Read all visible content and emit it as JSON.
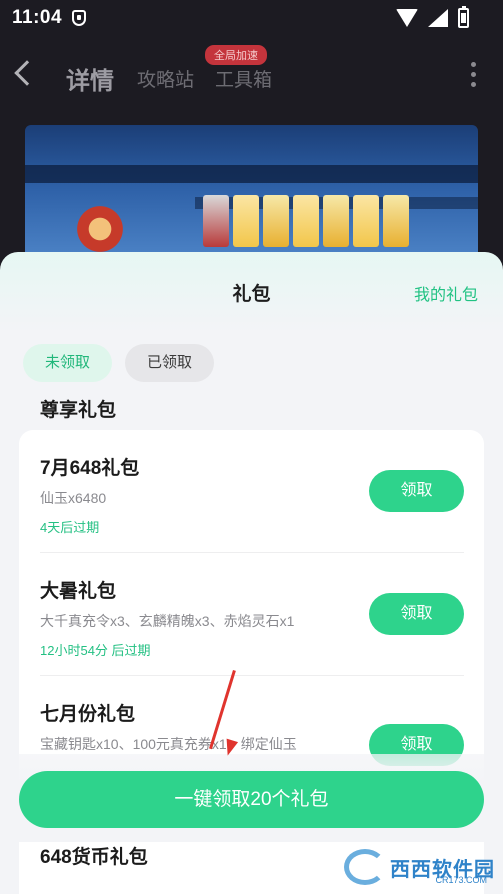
{
  "status_bar": {
    "time": "11:04"
  },
  "nav": {
    "back_icon": "back-arrow-icon",
    "title": "详情",
    "tabs": [
      "攻略站",
      "工具箱"
    ],
    "badge": "全局加速",
    "more_icon": "more-vertical-icon"
  },
  "sheet": {
    "title": "礼包",
    "my_gifts_link": "我的礼包",
    "segments": {
      "unclaimed": "未领取",
      "claimed": "已领取"
    },
    "section_title": "尊享礼包",
    "items": [
      {
        "name": "7月648礼包",
        "desc": "仙玉x6480",
        "expiry": "4天后过期",
        "button": "领取"
      },
      {
        "name": "大暑礼包",
        "desc": "大千真充令x3、玄麟精魄x3、赤焰灵石x1",
        "expiry": "12小时54分 后过期",
        "button": "领取"
      },
      {
        "name": "七月份礼包",
        "desc": "宝藏钥匙x10、100元真充券x1、绑定仙玉",
        "expiry": "",
        "button": "领取"
      }
    ],
    "bulk_button": "一键领取20个礼包",
    "next_item_title": "648货币礼包"
  },
  "watermark": {
    "text": "西西软件园",
    "sub": "CR173.COM"
  },
  "colors": {
    "accent": "#2ed38c",
    "accent_text": "#21c283",
    "badge": "#c4343c",
    "annotation_arrow": "#e0342e"
  }
}
